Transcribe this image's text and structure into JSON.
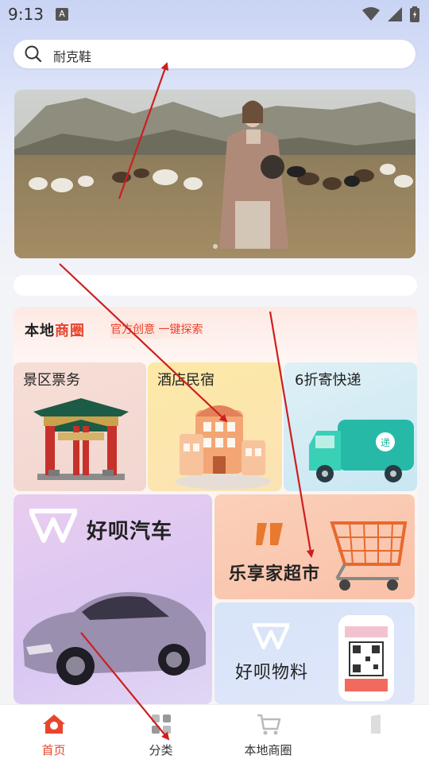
{
  "status_bar": {
    "time": "9:13",
    "notif_icon": "A"
  },
  "search": {
    "text": "耐克鞋"
  },
  "local": {
    "title_part1": "本地",
    "title_part2": "商圈",
    "subtitle": "官方创意 一键探索",
    "tiles": [
      {
        "label": "景区票务"
      },
      {
        "label": "酒店民宿"
      },
      {
        "label": "6折寄快递"
      }
    ],
    "promos": [
      {
        "label": "好呗汽车"
      },
      {
        "label": "乐享家超市"
      },
      {
        "label": "好呗物料"
      }
    ]
  },
  "nav": [
    {
      "label": "首页",
      "icon": "home-icon",
      "active": true
    },
    {
      "label": "分类",
      "icon": "category-icon",
      "active": false
    },
    {
      "label": "本地商圈",
      "icon": "cart-icon",
      "active": false
    },
    {
      "label": "",
      "icon": "profile-icon",
      "active": false
    }
  ],
  "colors": {
    "accent": "#e8452e",
    "annotation_arrow": "#cc1f1f"
  }
}
